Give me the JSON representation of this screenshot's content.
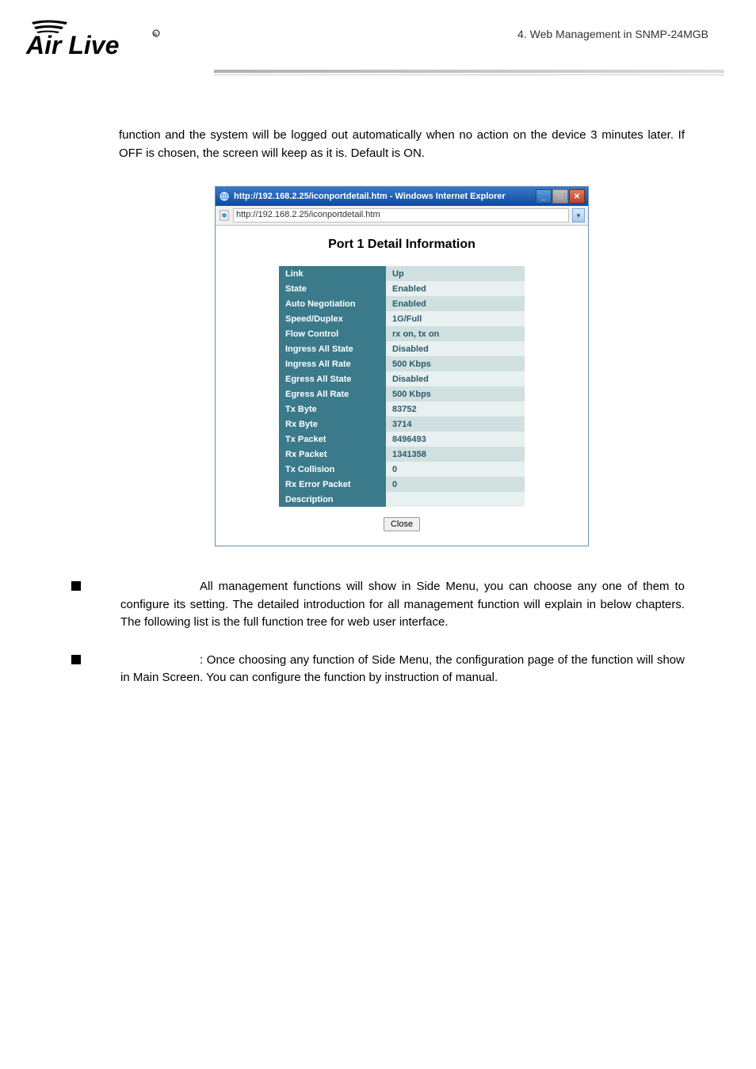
{
  "header": {
    "right_text": "4.  Web  Management  in  SNMP-24MGB",
    "logo_text": "Air Live"
  },
  "para1": "function and the system will be logged out automatically when no action on the device 3 minutes later. If OFF is chosen, the screen will keep as it is. Default is ON.",
  "window": {
    "title": "http://192.168.2.25/iconportdetail.htm - Windows Internet Explorer",
    "address": "http://192.168.2.25/iconportdetail.htm",
    "content_title": "Port 1 Detail Information",
    "close_button": "Close",
    "rows": [
      {
        "label": "Link",
        "value": "Up"
      },
      {
        "label": "State",
        "value": "Enabled"
      },
      {
        "label": "Auto Negotiation",
        "value": "Enabled"
      },
      {
        "label": "Speed/Duplex",
        "value": "1G/Full"
      },
      {
        "label": "Flow Control",
        "value": "rx on, tx on"
      },
      {
        "label": "Ingress All State",
        "value": "Disabled"
      },
      {
        "label": "Ingress All Rate",
        "value": "500 Kbps"
      },
      {
        "label": "Egress All State",
        "value": "Disabled"
      },
      {
        "label": "Egress All Rate",
        "value": "500 Kbps"
      },
      {
        "label": "Tx Byte",
        "value": "83752"
      },
      {
        "label": "Rx Byte",
        "value": "3714"
      },
      {
        "label": "Tx Packet",
        "value": "8496493"
      },
      {
        "label": "Rx Packet",
        "value": "1341358"
      },
      {
        "label": "Tx Collision",
        "value": "0"
      },
      {
        "label": "Rx Error Packet",
        "value": "0"
      },
      {
        "label": "Description",
        "value": ""
      }
    ]
  },
  "bullets": [
    "All management functions will show in Side Menu, you can choose any one of them to configure its setting. The detailed introduction for all management function will explain in below chapters. The following list is the full function tree for web user interface.",
    ": Once choosing any function of Side Menu, the configuration page of the function will show in Main Screen. You can configure the function by instruction of manual."
  ]
}
